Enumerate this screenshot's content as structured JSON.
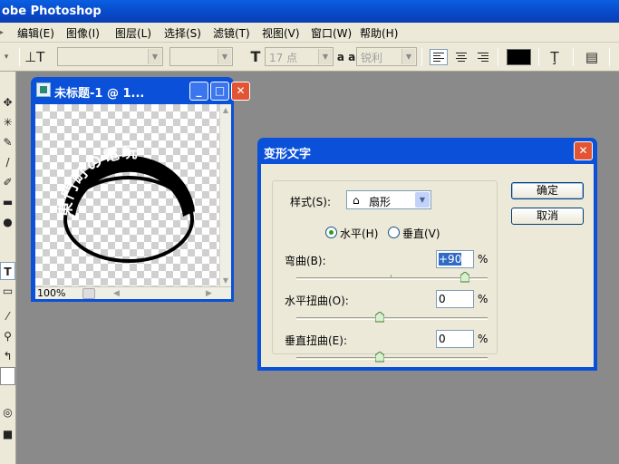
{
  "app": {
    "title": "obe Photoshop"
  },
  "menu": [
    "编辑(E)",
    "图像(I)",
    "图层(L)",
    "选择(S)",
    "滤镜(T)",
    "视图(V)",
    "窗口(W)",
    "帮助(H)"
  ],
  "options_bar": {
    "font_size": "17 点",
    "antialias_icon_text": "a a",
    "antialias_value": "锐利",
    "text_color": "#000000"
  },
  "document": {
    "title": "未标题-1 @ 1...",
    "zoom": "100%",
    "arc_text": "東門町の電玩"
  },
  "dialog": {
    "title": "变形文字",
    "style_label": "样式(S):",
    "style_value": "扇形",
    "orientation": {
      "horizontal_label": "水平(H)",
      "vertical_label": "垂直(V)",
      "selected": "horizontal"
    },
    "bend": {
      "label": "弯曲(B):",
      "value": "+90",
      "unit": "%",
      "slider_fraction": 0.95
    },
    "h_distortion": {
      "label": "水平扭曲(O):",
      "value": "0",
      "unit": "%",
      "slider_fraction": 0.5
    },
    "v_distortion": {
      "label": "垂直扭曲(E):",
      "value": "0",
      "unit": "%",
      "slider_fraction": 0.5
    },
    "ok_label": "确定",
    "cancel_label": "取消"
  }
}
